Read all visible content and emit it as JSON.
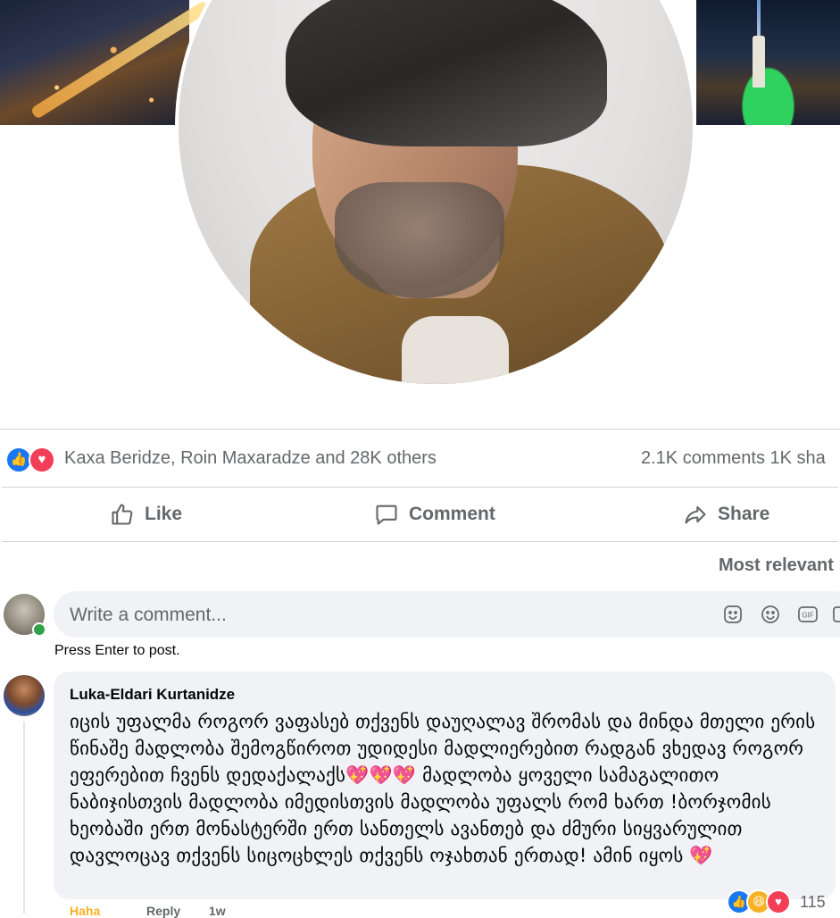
{
  "post": {
    "reactions_summary": "Kaxa Beridze, Roin Maxaradze and 28K others",
    "counts": "2.1K comments  1K sha",
    "reaction_icons": [
      "like-icon",
      "love-icon"
    ]
  },
  "actions": {
    "like": "Like",
    "comment": "Comment",
    "share": "Share"
  },
  "comments_filter": "Most relevant",
  "composer": {
    "placeholder": "Write a comment...",
    "hint": "Press Enter to post.",
    "icons": [
      "sticker-icon",
      "emoji-icon",
      "gif-icon",
      "photo-icon"
    ]
  },
  "comment": {
    "author": "Luka-Eldari Kurtanidze",
    "text": "იცის უფალმა როგორ ვაფასებ თქვენს დაუღალავ შრომას და მინდა მთელი ერის წინაშე მადლობა შემოგწიროთ უდიდესი მადლიერებით რადგან ვხედავ როგორ ეფერებით ჩვენს დედაქალაქს💖💖💖 მადლობა ყოველი სამაგალითო ნაბიჯისთვის მადლობა იმედისთვის მადლობა უფალს რომ ხართ !ბორჯომის ხეობაში ერთ მონასტერში ერთ სანთელს ავანთებ და ძმური სიყვარულით დავლოცავ თქვენს სიცოცხლეს თქვენს ოჯახთან ერთად! ამინ იყოს 💖",
    "reaction_count": "115",
    "footer_react": "Haha",
    "footer_reply": "Reply",
    "footer_time": "1w"
  },
  "colors": {
    "accent": "#1877f2",
    "love": "#f33e58",
    "haha": "#f7b125",
    "muted_text": "#65676b",
    "bubble_bg": "#f0f2f5"
  }
}
